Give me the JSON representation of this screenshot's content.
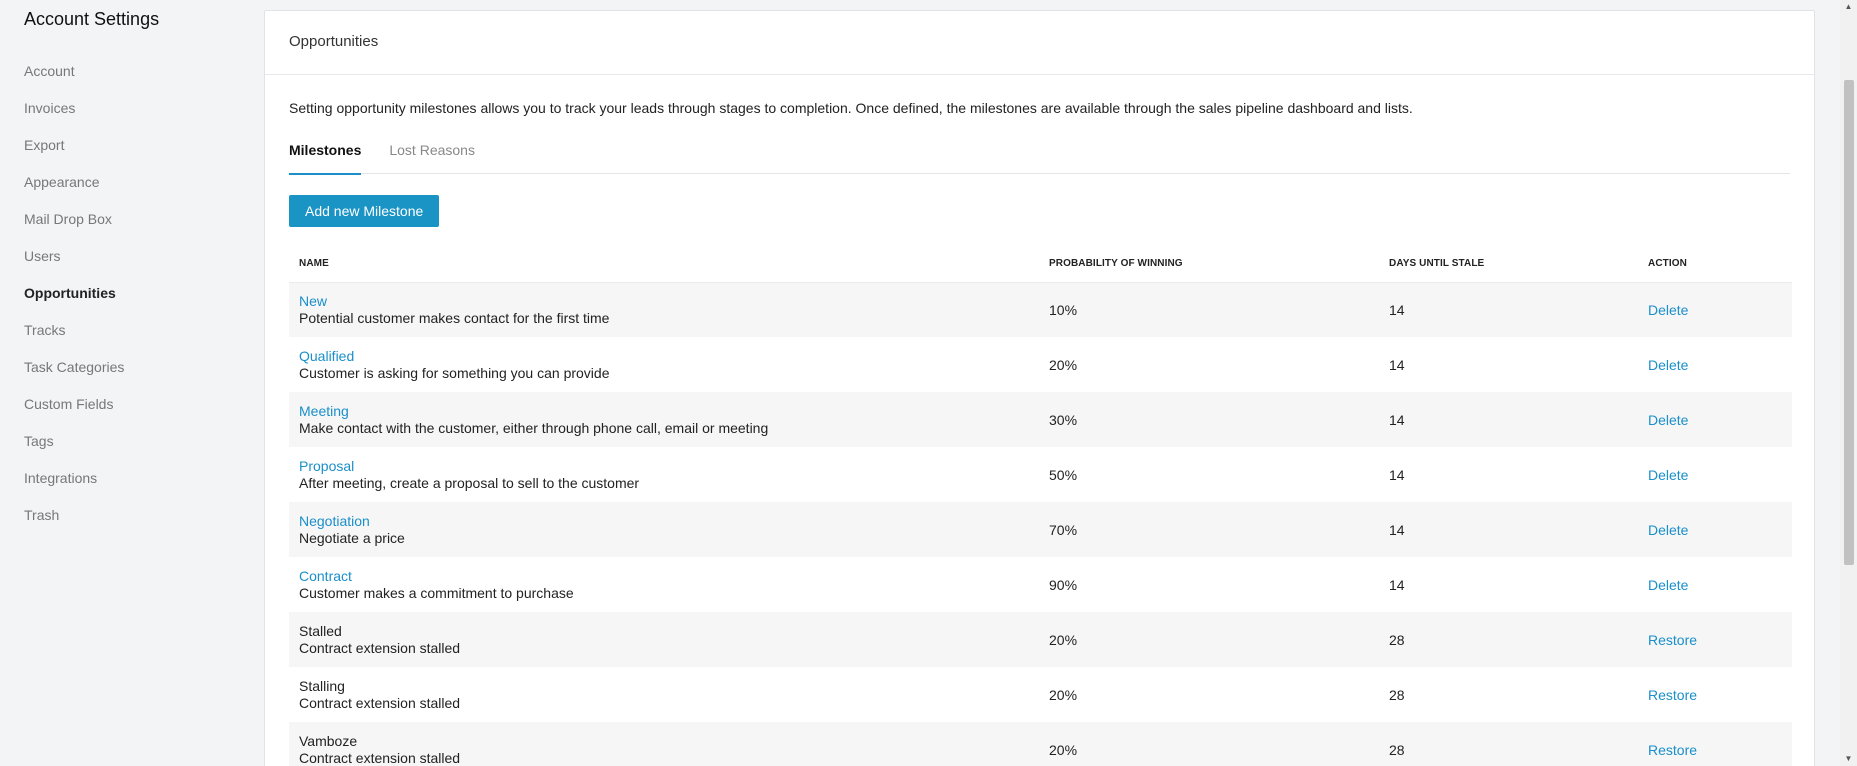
{
  "sidebar": {
    "title": "Account Settings",
    "items": [
      {
        "label": "Account",
        "active": false
      },
      {
        "label": "Invoices",
        "active": false
      },
      {
        "label": "Export",
        "active": false
      },
      {
        "label": "Appearance",
        "active": false
      },
      {
        "label": "Mail Drop Box",
        "active": false
      },
      {
        "label": "Users",
        "active": false
      },
      {
        "label": "Opportunities",
        "active": true
      },
      {
        "label": "Tracks",
        "active": false
      },
      {
        "label": "Task Categories",
        "active": false
      },
      {
        "label": "Custom Fields",
        "active": false
      },
      {
        "label": "Tags",
        "active": false
      },
      {
        "label": "Integrations",
        "active": false
      },
      {
        "label": "Trash",
        "active": false
      }
    ]
  },
  "panel": {
    "title": "Opportunities",
    "intro": "Setting opportunity milestones allows you to track your leads through stages to completion. Once defined, the milestones are available through the sales pipeline dashboard and lists.",
    "tabs": [
      {
        "label": "Milestones",
        "active": true
      },
      {
        "label": "Lost Reasons",
        "active": false
      }
    ],
    "add_button_label": "Add new Milestone"
  },
  "table": {
    "headers": {
      "name": "NAME",
      "probability": "PROBABILITY OF WINNING",
      "days": "DAYS UNTIL STALE",
      "action": "ACTION"
    },
    "rows": [
      {
        "name": "New",
        "description": "Potential customer makes contact for the first time",
        "probability": "10%",
        "days": "14",
        "action": "Delete",
        "linked": true
      },
      {
        "name": "Qualified",
        "description": "Customer is asking for something you can provide",
        "probability": "20%",
        "days": "14",
        "action": "Delete",
        "linked": true
      },
      {
        "name": "Meeting",
        "description": "Make contact with the customer, either through phone call, email or meeting",
        "probability": "30%",
        "days": "14",
        "action": "Delete",
        "linked": true
      },
      {
        "name": "Proposal",
        "description": "After meeting, create a proposal to sell to the customer",
        "probability": "50%",
        "days": "14",
        "action": "Delete",
        "linked": true
      },
      {
        "name": "Negotiation",
        "description": "Negotiate a price",
        "probability": "70%",
        "days": "14",
        "action": "Delete",
        "linked": true
      },
      {
        "name": "Contract",
        "description": "Customer makes a commitment to purchase",
        "probability": "90%",
        "days": "14",
        "action": "Delete",
        "linked": true
      },
      {
        "name": "Stalled",
        "description": "Contract extension stalled",
        "probability": "20%",
        "days": "28",
        "action": "Restore",
        "linked": false
      },
      {
        "name": "Stalling",
        "description": "Contract extension stalled",
        "probability": "20%",
        "days": "28",
        "action": "Restore",
        "linked": false
      },
      {
        "name": "Vamboze",
        "description": "Contract extension stalled",
        "probability": "20%",
        "days": "28",
        "action": "Restore",
        "linked": false
      }
    ]
  },
  "colors": {
    "accent": "#1a8fc9",
    "button": "#1a93c5",
    "background": "#f3f4f6",
    "row_stripe": "#f6f6f7"
  }
}
